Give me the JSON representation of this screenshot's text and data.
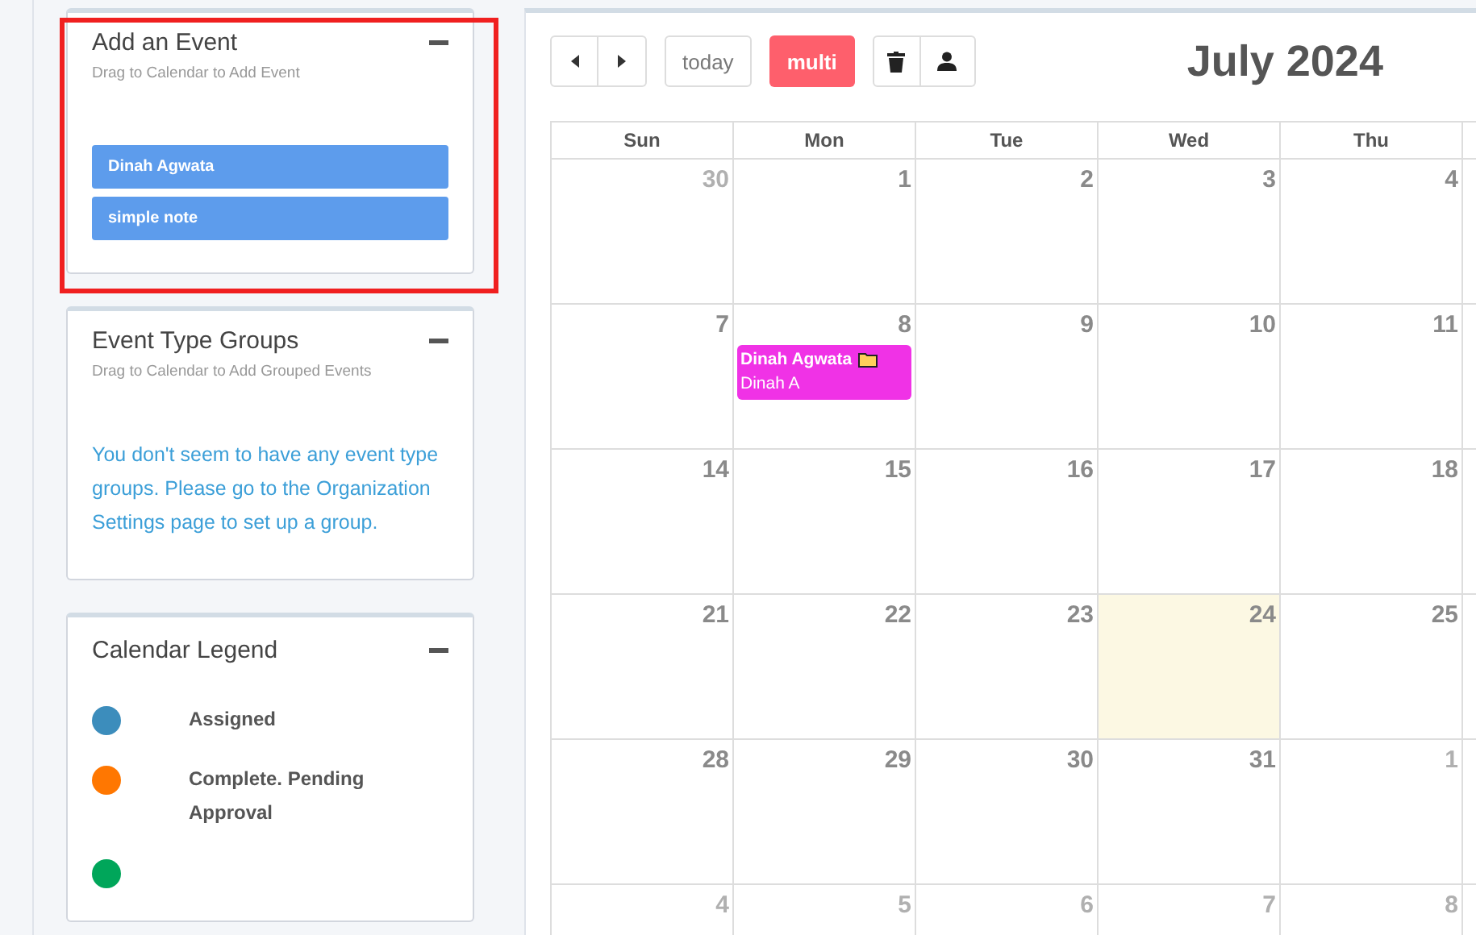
{
  "add_event": {
    "title": "Add an Event",
    "subtitle": "Drag to Calendar to Add Event",
    "highlighted": true,
    "items": [
      "Dinah Agwata",
      "simple note"
    ]
  },
  "event_groups": {
    "title": "Event Type Groups",
    "subtitle": "Drag to Calendar to Add Grouped Events",
    "message": "You don't seem to have any event type groups. Please go to the Organization Settings page to set up a group."
  },
  "legend": {
    "title": "Calendar Legend",
    "items": [
      {
        "label": "Assigned",
        "color": "#3c8dbc"
      },
      {
        "label": "Complete. Pending Approval",
        "color": "#ff7701"
      },
      {
        "color": "#00a65a"
      }
    ]
  },
  "calendar": {
    "toolbar": {
      "today": "today",
      "multi": {
        "label": "multi",
        "on": true
      }
    },
    "title": "July 2024",
    "days": [
      "Sun",
      "Mon",
      "Tue",
      "Wed",
      "Thu"
    ],
    "weeks": [
      [
        {
          "number": "30",
          "muted": true,
          "today": false
        },
        {
          "number": "1",
          "muted": false,
          "today": false
        },
        {
          "number": "2",
          "muted": false,
          "today": false
        },
        {
          "number": "3",
          "muted": false,
          "today": false
        },
        {
          "number": "4",
          "muted": false,
          "today": false
        }
      ],
      [
        {
          "number": "7",
          "muted": false,
          "today": false
        },
        {
          "number": "8",
          "muted": false,
          "today": false,
          "events": [
            {
              "title": "Dinah Agwata",
              "subtitle": "Dinah A",
              "color": "#f032e6"
            }
          ]
        },
        {
          "number": "9",
          "muted": false,
          "today": false
        },
        {
          "number": "10",
          "muted": false,
          "today": false
        },
        {
          "number": "11",
          "muted": false,
          "today": false
        }
      ],
      [
        {
          "number": "14",
          "muted": false,
          "today": false
        },
        {
          "number": "15",
          "muted": false,
          "today": false
        },
        {
          "number": "16",
          "muted": false,
          "today": false
        },
        {
          "number": "17",
          "muted": false,
          "today": false
        },
        {
          "number": "18",
          "muted": false,
          "today": false
        }
      ],
      [
        {
          "number": "21",
          "muted": false,
          "today": false
        },
        {
          "number": "22",
          "muted": false,
          "today": false
        },
        {
          "number": "23",
          "muted": false,
          "today": false
        },
        {
          "number": "24",
          "muted": false,
          "today": true
        },
        {
          "number": "25",
          "muted": false,
          "today": false
        }
      ],
      [
        {
          "number": "28",
          "muted": false,
          "today": false
        },
        {
          "number": "29",
          "muted": false,
          "today": false
        },
        {
          "number": "30",
          "muted": false,
          "today": false
        },
        {
          "number": "31",
          "muted": false,
          "today": false
        },
        {
          "number": "1",
          "muted": true,
          "today": false
        }
      ],
      [
        {
          "number": "4",
          "muted": true,
          "today": false
        },
        {
          "number": "5",
          "muted": true,
          "today": false
        },
        {
          "number": "6",
          "muted": true,
          "today": false
        },
        {
          "number": "7",
          "muted": true,
          "today": false
        },
        {
          "number": "8",
          "muted": true,
          "today": false
        }
      ]
    ]
  }
}
